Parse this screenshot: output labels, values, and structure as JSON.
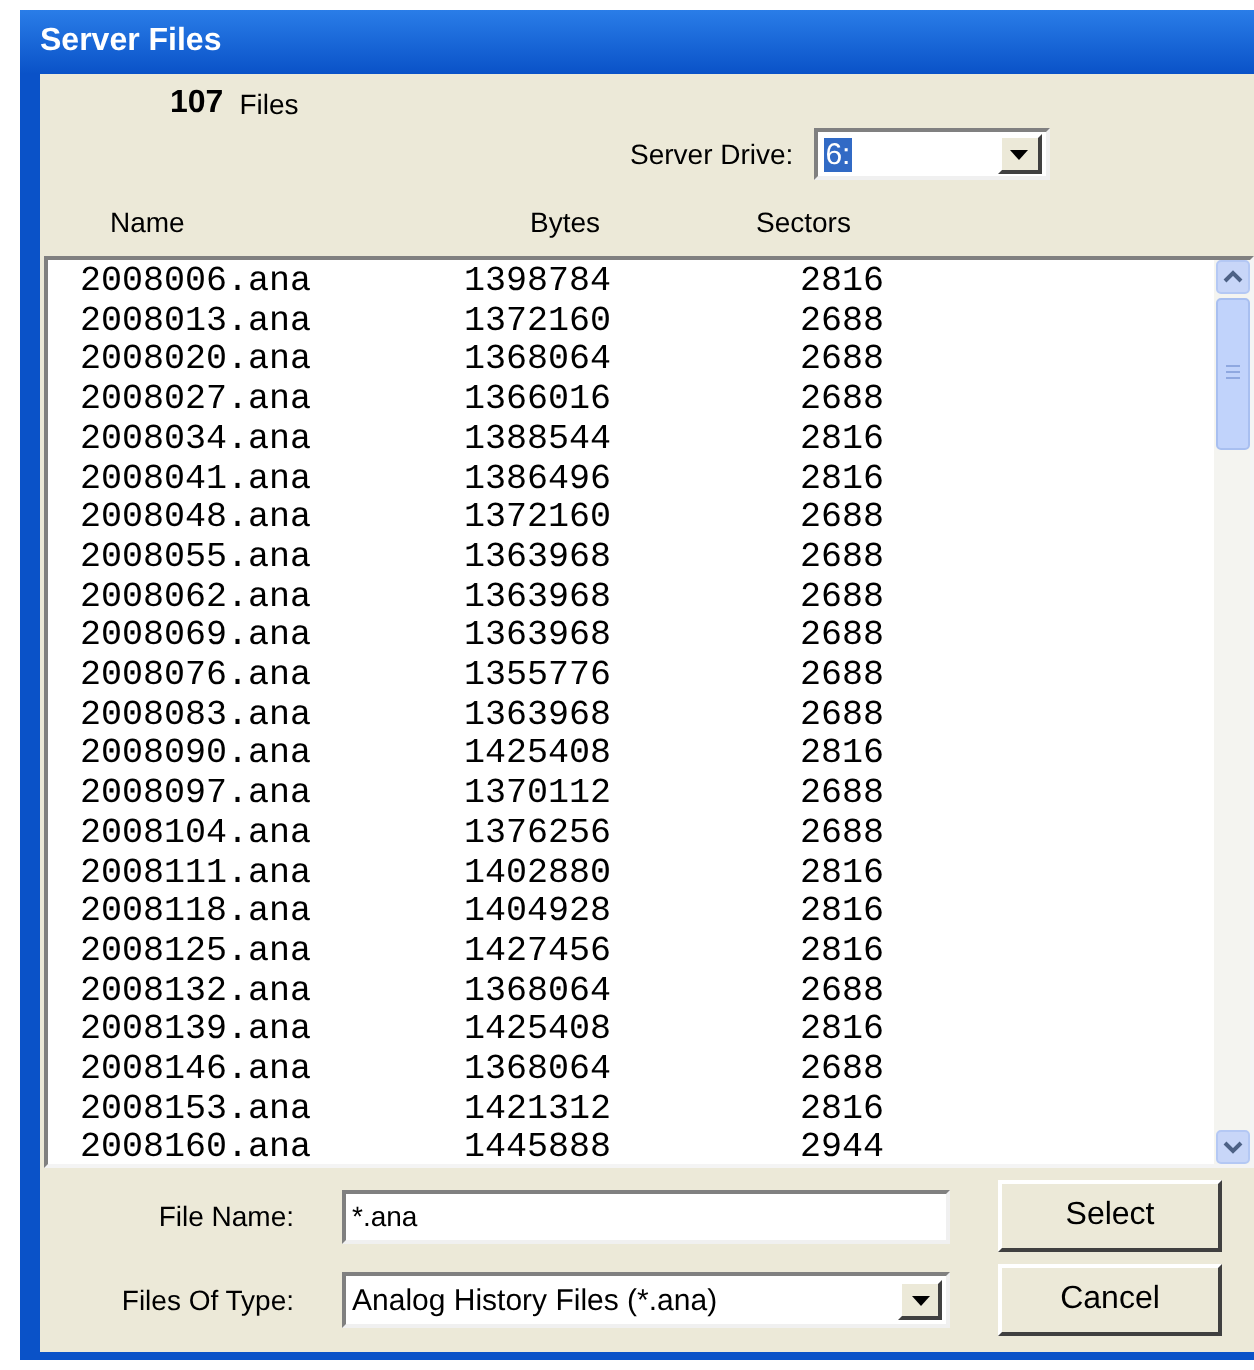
{
  "window": {
    "title": "Server Files"
  },
  "file_count": {
    "number": "107",
    "label": "Files"
  },
  "server_drive": {
    "label": "Server Drive:",
    "value": "6:",
    "selected": true
  },
  "columns": [
    "Name",
    "Bytes",
    "Sectors"
  ],
  "rows": [
    [
      "2008006.ana",
      "1398784",
      "2816"
    ],
    [
      "2008013.ana",
      "1372160",
      "2688"
    ],
    [
      "2008020.ana",
      "1368064",
      "2688"
    ],
    [
      "2008027.ana",
      "1366016",
      "2688"
    ],
    [
      "2008034.ana",
      "1388544",
      "2816"
    ],
    [
      "2008041.ana",
      "1386496",
      "2816"
    ],
    [
      "2008048.ana",
      "1372160",
      "2688"
    ],
    [
      "2008055.ana",
      "1363968",
      "2688"
    ],
    [
      "2008062.ana",
      "1363968",
      "2688"
    ],
    [
      "2008069.ana",
      "1363968",
      "2688"
    ],
    [
      "2008076.ana",
      "1355776",
      "2688"
    ],
    [
      "2008083.ana",
      "1363968",
      "2688"
    ],
    [
      "2008090.ana",
      "1425408",
      "2816"
    ],
    [
      "2008097.ana",
      "1370112",
      "2688"
    ],
    [
      "2008104.ana",
      "1376256",
      "2688"
    ],
    [
      "2008111.ana",
      "1402880",
      "2816"
    ],
    [
      "2008118.ana",
      "1404928",
      "2816"
    ],
    [
      "2008125.ana",
      "1427456",
      "2816"
    ],
    [
      "2008132.ana",
      "1368064",
      "2688"
    ],
    [
      "2008139.ana",
      "1425408",
      "2816"
    ],
    [
      "2008146.ana",
      "1368064",
      "2688"
    ],
    [
      "2008153.ana",
      "1421312",
      "2816"
    ],
    [
      "2008160.ana",
      "1445888",
      "2944"
    ]
  ],
  "file_name": {
    "label": "File Name:",
    "value": "*.ana"
  },
  "files_of_type": {
    "label": "Files Of Type:",
    "value": "Analog History Files (*.ana)"
  },
  "buttons": [
    "Select",
    "Cancel"
  ]
}
